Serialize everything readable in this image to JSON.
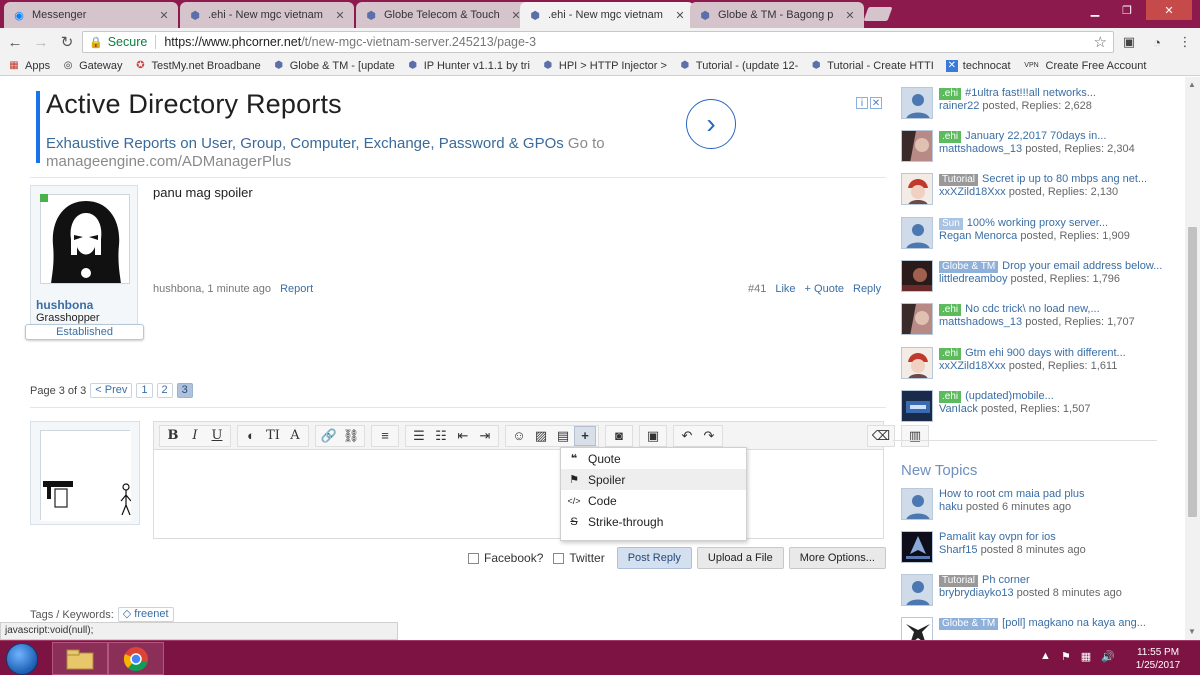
{
  "browser": {
    "tabs": [
      {
        "title": "Messenger",
        "active": false,
        "icon": "messenger-icon"
      },
      {
        "title": ".ehi - New mgc vietnam",
        "active": false,
        "icon": "phcorner-icon"
      },
      {
        "title": "Globe Telecom & Touch",
        "active": false,
        "icon": "phcorner-icon"
      },
      {
        "title": ".ehi - New mgc vietnam",
        "active": true,
        "icon": "phcorner-icon"
      },
      {
        "title": "Globe & TM - Bagong p",
        "active": false,
        "icon": "phcorner-icon"
      }
    ],
    "address": {
      "secure_label": "Secure",
      "url_host": "https://www.phcorner.net",
      "url_path": "/t/new-mgc-vietnam-server.245213/page-3"
    },
    "bookmarks": [
      {
        "label": "Apps",
        "icon": "apps-icon"
      },
      {
        "label": "Gateway",
        "icon": "gateway-icon"
      },
      {
        "label": "TestMy.net Broadbane",
        "icon": "testmy-icon"
      },
      {
        "label": "Globe & TM - [update",
        "icon": "phcorner-icon"
      },
      {
        "label": "IP Hunter v1.1.1 by tri",
        "icon": "phcorner-icon"
      },
      {
        "label": "HPI > HTTP Injector >",
        "icon": "phcorner-icon"
      },
      {
        "label": "Tutorial - (update 12-",
        "icon": "phcorner-icon"
      },
      {
        "label": "Tutorial - Create HTTI",
        "icon": "phcorner-icon"
      },
      {
        "label": "technocat",
        "icon": "technocat-icon"
      },
      {
        "label": "Create Free Account",
        "icon": "vpn-icon"
      }
    ]
  },
  "ad": {
    "title": "Active Directory Reports",
    "description": "Exhaustive Reports on User, Group, Computer, Exchange, Password & GPOs",
    "goto": "Go to",
    "url": "manageengine.com/ADManagerPlus"
  },
  "post": {
    "username": "hushbona",
    "user_title": "Grasshopper",
    "ribbon": "Established",
    "message": "panu mag spoiler",
    "meta_author": "hushbona, 1 minute ago",
    "report_label": "Report",
    "post_number": "#41",
    "like_label": "Like",
    "quote_label": "+ Quote",
    "reply_label": "Reply"
  },
  "pagination": {
    "label": "Page 3 of 3",
    "prev": "< Prev",
    "pages": [
      "1",
      "2",
      "3"
    ],
    "current": "3"
  },
  "editor": {
    "dropdown": [
      {
        "label": "Quote",
        "icon": "quote-icon"
      },
      {
        "label": "Spoiler",
        "icon": "flag-icon"
      },
      {
        "label": "Code",
        "icon": "code-icon"
      },
      {
        "label": "Strike-through",
        "icon": "strikethrough-icon"
      }
    ],
    "facebook_label": "Facebook?",
    "twitter_label": "Twitter",
    "post_reply": "Post Reply",
    "upload": "Upload a File",
    "more_options": "More Options..."
  },
  "tags": {
    "label": "Tags / Keywords:",
    "items": [
      "freenet"
    ]
  },
  "statusbar": "javascript:void(null);",
  "sidebar": {
    "threads": [
      {
        "tag": ".ehi",
        "tag_color": "green",
        "title": "#1ultra fast!!!all networks...",
        "user": "rainer22",
        "meta": "posted, Replies: 2,628"
      },
      {
        "tag": ".ehi",
        "tag_color": "green",
        "title": "January 22,2017 70days in...",
        "user": "mattshadows_13",
        "meta": "posted, Replies: 2,304"
      },
      {
        "tag": "Tutorial",
        "tag_color": "grey",
        "title": "Secret ip up to 80 mbps ang net...",
        "user": "xxXZild18Xxx",
        "meta": "posted, Replies: 2,130"
      },
      {
        "tag": "Sun",
        "tag_color": "lblue",
        "title": "100% working proxy server...",
        "user": "Regan Menorca",
        "meta": "posted, Replies: 1,909"
      },
      {
        "tag": "Globe & TM",
        "tag_color": "blue",
        "title": "Drop your email address below...",
        "user": "littledreamboy",
        "meta": "posted, Replies: 1,796"
      },
      {
        "tag": ".ehi",
        "tag_color": "green",
        "title": "No cdc trick\\ no load new,...",
        "user": "mattshadows_13",
        "meta": "posted, Replies: 1,707"
      },
      {
        "tag": ".ehi",
        "tag_color": "green",
        "title": "Gtm ehi 900 days with different...",
        "user": "xxXZild18Xxx",
        "meta": "posted, Replies: 1,611"
      },
      {
        "tag": ".ehi",
        "tag_color": "green",
        "title": "(updated)mobile...",
        "user": "VanIack",
        "meta": "posted, Replies: 1,507"
      }
    ],
    "new_topics_heading": "New Topics",
    "new_topics": [
      {
        "tag": "",
        "title": "How to root cm maia pad plus",
        "user": "haku",
        "meta": "posted 6 minutes ago"
      },
      {
        "tag": "",
        "title": "Pamalit kay ovpn for ios",
        "user": "Sharf15",
        "meta": "posted 8 minutes ago"
      },
      {
        "tag": "Tutorial",
        "tag_color": "grey",
        "title": "Ph corner",
        "user": "brybrydiayko13",
        "meta": "posted 8 minutes ago"
      },
      {
        "tag": "Globe & TM",
        "tag_color": "blue",
        "title": "[poll] magkano na kaya ang...",
        "user": "",
        "meta": ""
      }
    ]
  },
  "taskbar": {
    "time": "11:55 PM",
    "date": "1/25/2017"
  }
}
